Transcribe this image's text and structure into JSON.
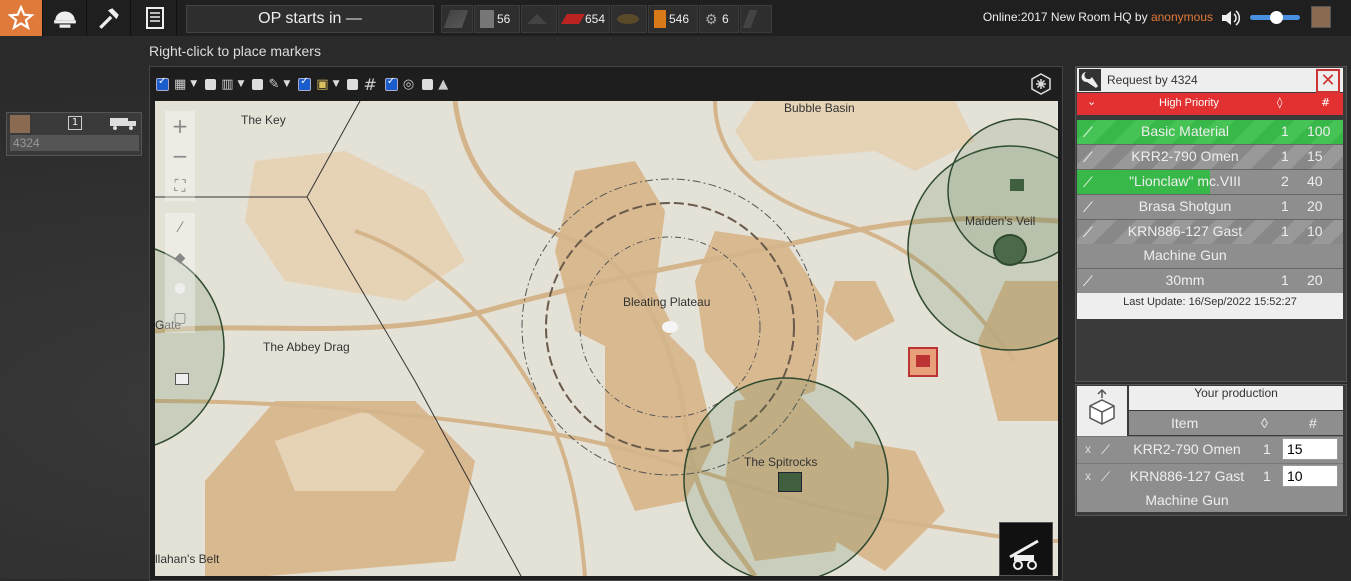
{
  "topbar": {
    "op_status": "OP starts in —",
    "resources": [
      {
        "icon": "basic-materials-icon",
        "value": ""
      },
      {
        "icon": "salvage-icon",
        "value": "56"
      },
      {
        "icon": "components-icon",
        "value": ""
      },
      {
        "icon": "explosive-materials-icon",
        "value": "654"
      },
      {
        "icon": "heavy-explosive-icon",
        "value": ""
      },
      {
        "icon": "diesel-icon",
        "value": "546"
      },
      {
        "icon": "gear-parts-icon",
        "value": "6"
      },
      {
        "icon": "petrol-icon",
        "value": ""
      }
    ],
    "online_label": "Online:2017",
    "room_label": "New Room HQ by",
    "room_owner": "anonymous"
  },
  "hint": "Right-click to place markers",
  "player": {
    "name": "4324",
    "number": "1"
  },
  "map": {
    "labels": [
      "The Key",
      "Bubble Basin",
      "Maiden's Veil",
      "Gate",
      "The Abbey Drag",
      "Bleating Plateau",
      "The Spitrocks",
      "llahan's Belt"
    ]
  },
  "request": {
    "title": "Request by 4324",
    "priority": "High Priority",
    "count_header": "#",
    "items": [
      {
        "name": "Basic Material",
        "qty": "1",
        "total": "100"
      },
      {
        "name": "KRR2-790 Omen",
        "qty": "1",
        "total": "15"
      },
      {
        "name": "\"Lionclaw\" mc.VIII",
        "qty": "2",
        "total": "40"
      },
      {
        "name": "Brasa Shotgun",
        "qty": "1",
        "total": "20"
      },
      {
        "name": "KRN886-127 Gast",
        "name2": "Machine Gun",
        "qty": "1",
        "total": "10"
      },
      {
        "name": "30mm",
        "qty": "1",
        "total": "20"
      }
    ],
    "last_update": "Last Update: 16/Sep/2022 15:52:27"
  },
  "production": {
    "title": "Your production",
    "item_header": "Item",
    "count_header": "#",
    "rows": [
      {
        "name": "KRR2-790 Omen",
        "qty": "1",
        "value": "15"
      },
      {
        "name": "KRN886-127 Gast",
        "name2": "Machine Gun",
        "qty": "1",
        "value": "10"
      }
    ]
  },
  "colors": {
    "accent": "#e07a3a",
    "high_priority": "#e33030",
    "fulfilled": "#38b848"
  }
}
